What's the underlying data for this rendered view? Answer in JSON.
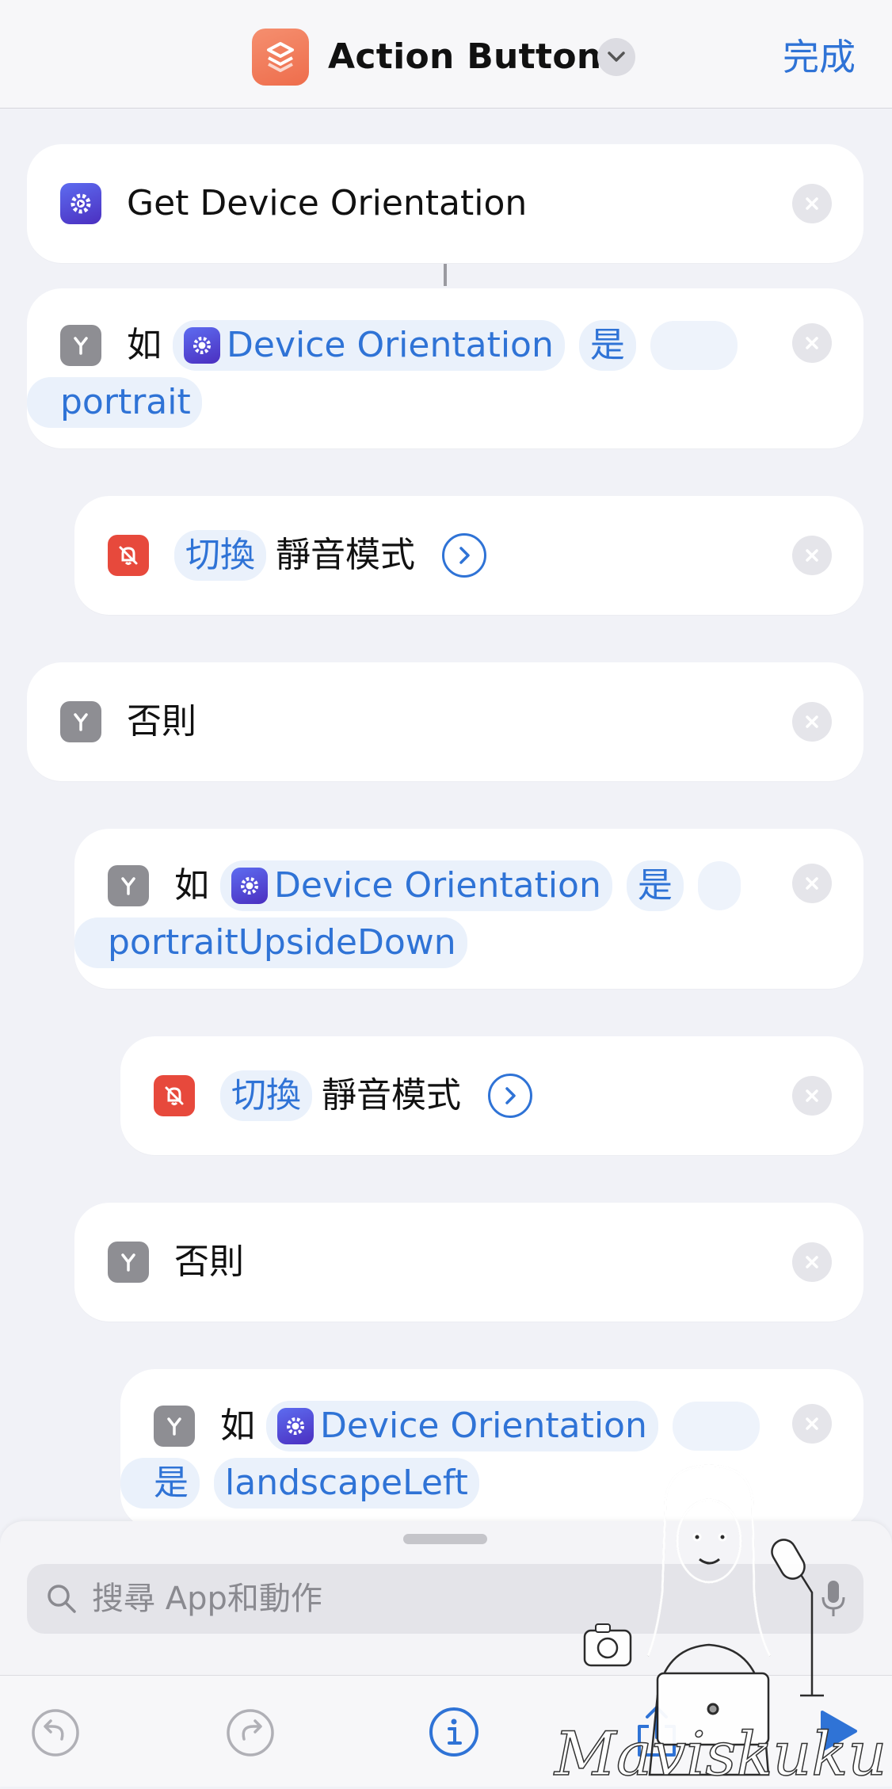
{
  "nav": {
    "title": "Action Button",
    "done_label": "完成"
  },
  "actions": {
    "get_orientation": {
      "label": "Get Device Orientation"
    },
    "if1": {
      "keyword": "如",
      "variable": "Device Orientation",
      "condition": "是",
      "value": "portrait"
    },
    "toggle1": {
      "verb": "切換",
      "target": "靜音模式"
    },
    "otherwise1": {
      "label": "否則"
    },
    "if2": {
      "keyword": "如",
      "variable": "Device Orientation",
      "condition": "是",
      "value": "portraitUpsideDown"
    },
    "toggle2": {
      "verb": "切換",
      "target": "靜音模式"
    },
    "otherwise2": {
      "label": "否則"
    },
    "if3": {
      "keyword": "如",
      "variable": "Device Orientation",
      "condition": "是",
      "value": "landscapeLeft"
    }
  },
  "search": {
    "placeholder": "搜尋 App和動作"
  },
  "watermark": {
    "text": "Maviskuku"
  },
  "icons": {
    "shortcuts": "shortcuts-app-icon",
    "gear": "device-gear-icon",
    "if": "branch-icon",
    "mute": "bell-slash-icon"
  },
  "colors": {
    "accent": "#2f73d6",
    "background": "#f1f2f7",
    "mute_red": "#e7493c",
    "branch_grey": "#8e8e93"
  }
}
